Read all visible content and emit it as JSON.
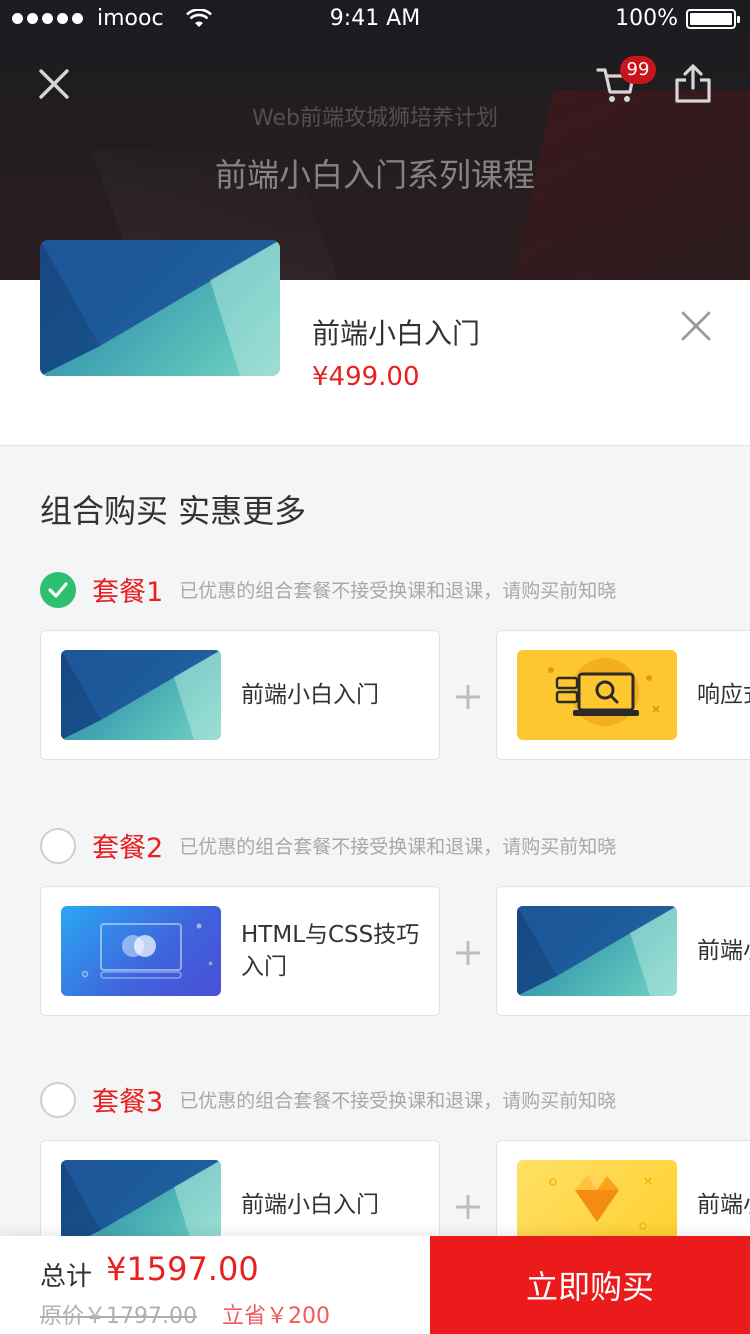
{
  "status_bar": {
    "carrier": "imooc",
    "time": "9:41 AM",
    "battery": "100%"
  },
  "header": {
    "cart_badge": "99",
    "subtitle": "Web前端攻城狮培养计划",
    "title": "前端小白入门系列课程"
  },
  "product": {
    "name": "前端小白入门",
    "price": "¥499.00"
  },
  "combo": {
    "heading": "组合购买 实惠更多",
    "packages": [
      {
        "name": "套餐1",
        "note": "已优惠的组合套餐不接受换课和退课，请购买前知晓",
        "selected": true,
        "courses": [
          {
            "title": "前端小白入门",
            "thumb": "blue-envelope"
          },
          {
            "title": "响应式",
            "thumb": "yellow-search-laptop"
          }
        ]
      },
      {
        "name": "套餐2",
        "note": "已优惠的组合套餐不接受换课和退课，请购买前知晓",
        "selected": false,
        "courses": [
          {
            "title": "HTML与CSS技巧入门",
            "thumb": "blue-player"
          },
          {
            "title": "前端小白入门",
            "thumb": "blue-envelope"
          }
        ]
      },
      {
        "name": "套餐3",
        "note": "已优惠的组合套餐不接受换课和退课，请购买前知晓",
        "selected": false,
        "courses": [
          {
            "title": "前端小白入门",
            "thumb": "blue-envelope"
          },
          {
            "title": "前端小白入门",
            "thumb": "gold-gem"
          }
        ]
      }
    ]
  },
  "bottom": {
    "total_label": "总计",
    "total_value": "¥1597.00",
    "original_price": "原价￥1797.00",
    "saving": "立省￥200",
    "buy_label": "立即购买"
  },
  "colors": {
    "accent_red": "#e8201f",
    "check_green": "#2fbf71",
    "buy_button": "#ec1b1b"
  }
}
